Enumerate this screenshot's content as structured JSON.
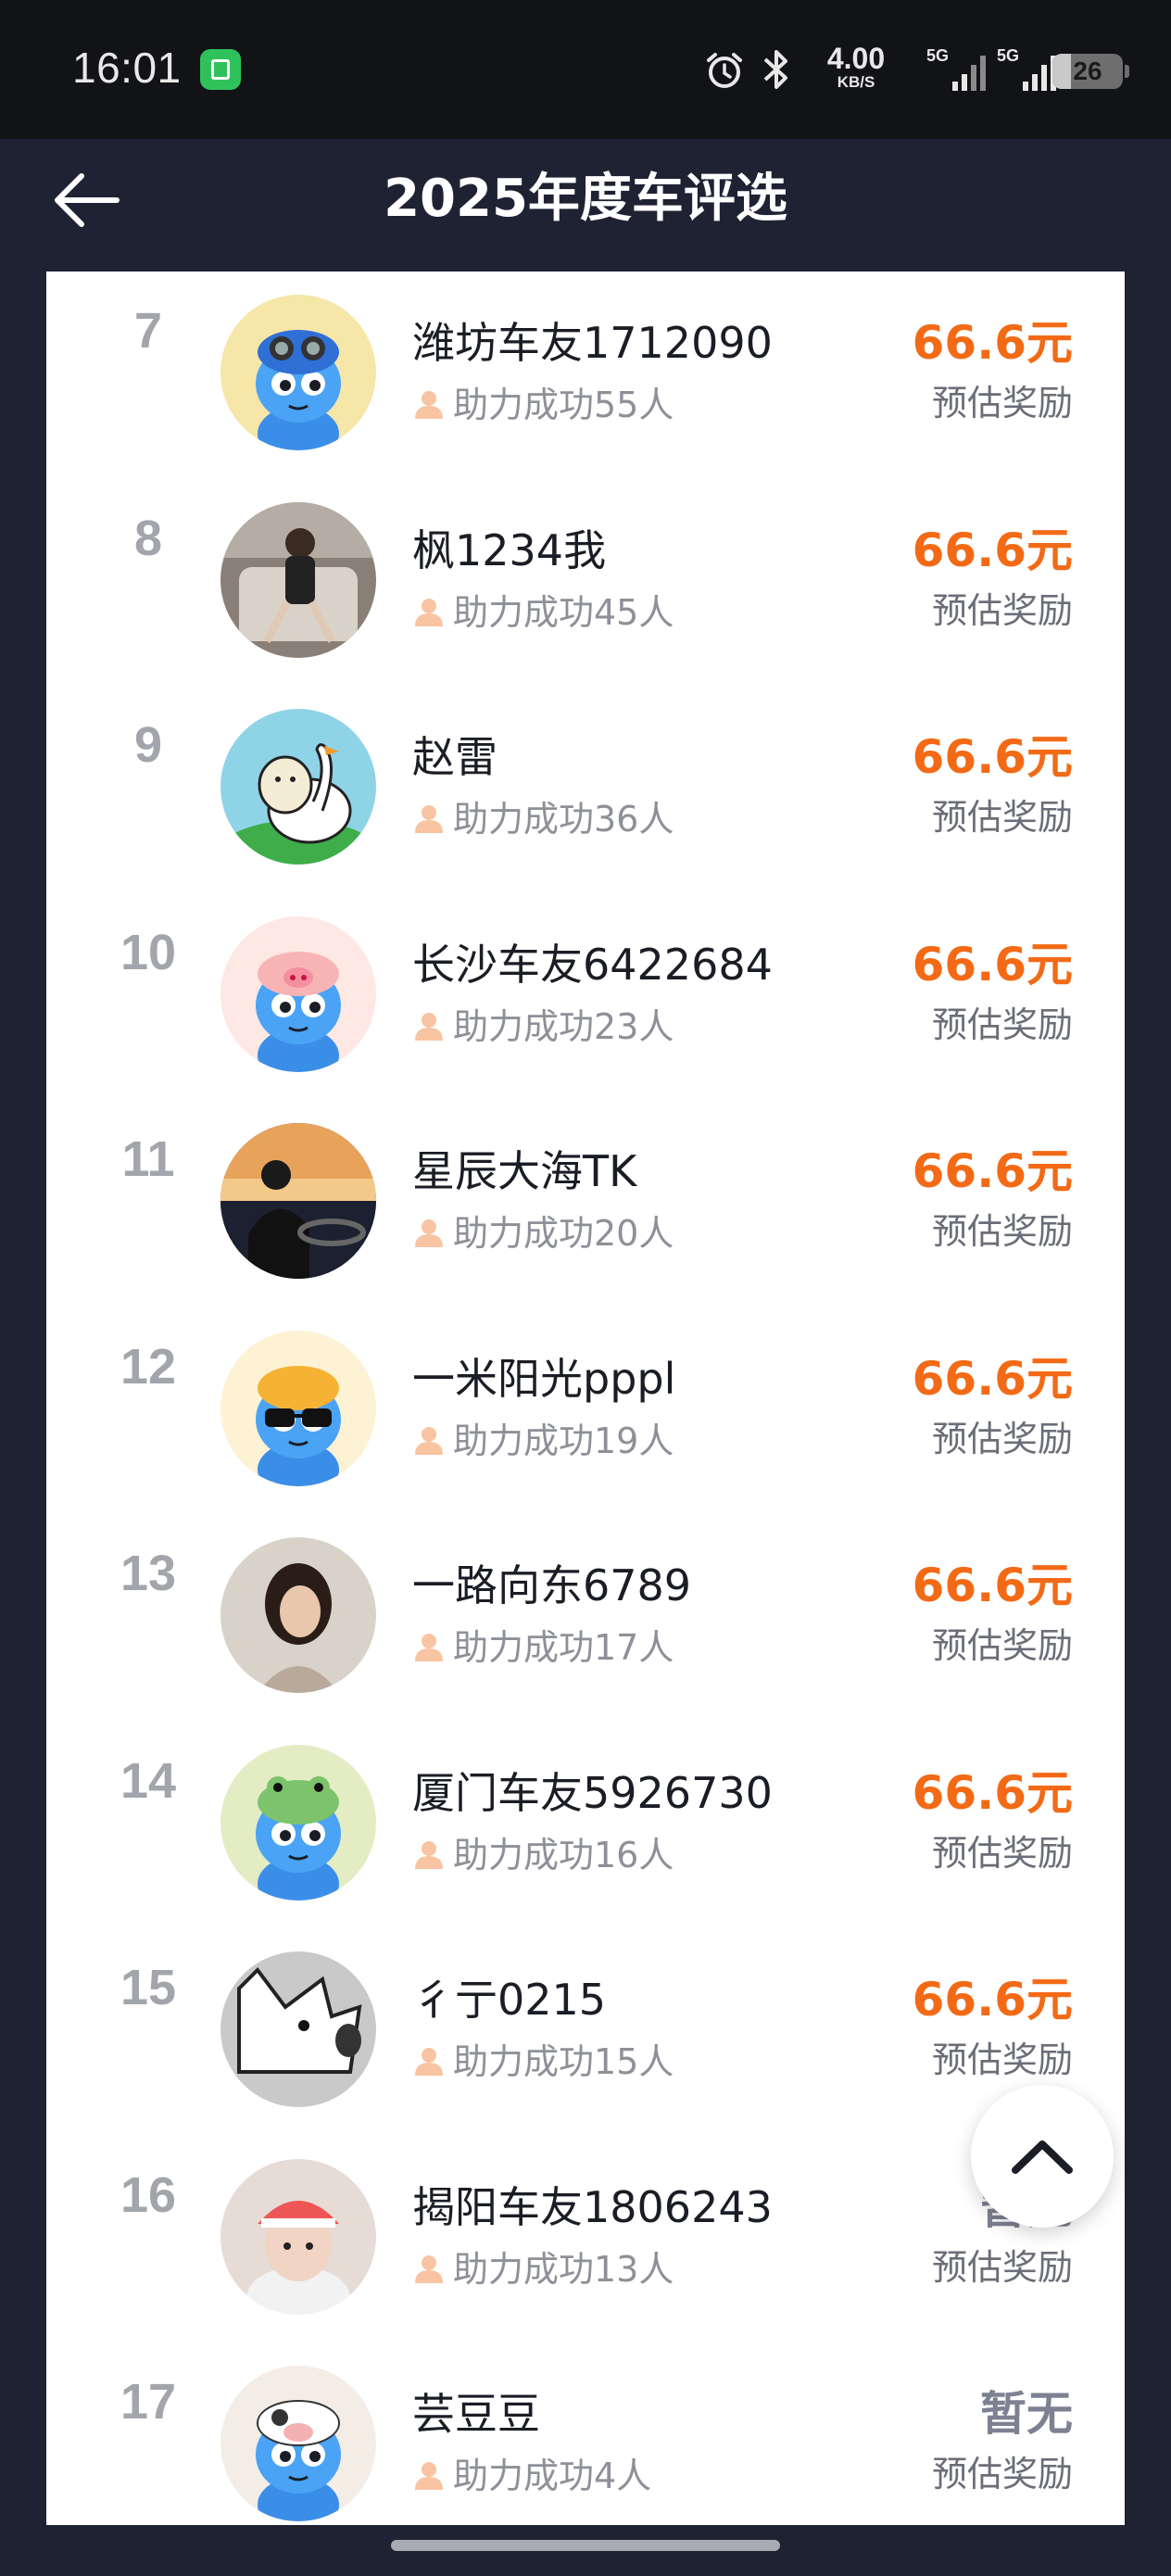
{
  "status_bar": {
    "time": "16:01",
    "net_speed_value": "4.00",
    "net_speed_unit": "KB/S",
    "sim1_tag": "5G",
    "sim2_tag": "5G",
    "battery": "26",
    "battery_level": 0.26
  },
  "header": {
    "title": "2025年度车评选",
    "back_icon": "arrow-left-icon"
  },
  "colors": {
    "reward": "#f36a16",
    "reward_none": "#7d8191",
    "rank": "#a3a5ac",
    "background": "#1e2233"
  },
  "list": [
    {
      "rank": "7",
      "name": "潍坊车友1712090",
      "helped": "助力成功55人",
      "reward": "66.6元",
      "reward_label": "预估奖励",
      "has_reward": true,
      "avatar": "blue-mascot-goggles"
    },
    {
      "rank": "8",
      "name": "枫1234我",
      "helped": "助力成功45人",
      "reward": "66.6元",
      "reward_label": "预估奖励",
      "has_reward": true,
      "avatar": "photo-woman-sofa"
    },
    {
      "rank": "9",
      "name": "赵雷",
      "helped": "助力成功36人",
      "reward": "66.6元",
      "reward_label": "预估奖励",
      "has_reward": true,
      "avatar": "cat-and-goose"
    },
    {
      "rank": "10",
      "name": "长沙车友6422684",
      "helped": "助力成功23人",
      "reward": "66.6元",
      "reward_label": "预估奖励",
      "has_reward": true,
      "avatar": "blue-mascot-pig-hat"
    },
    {
      "rank": "11",
      "name": "星辰大海TK",
      "helped": "助力成功20人",
      "reward": "66.6元",
      "reward_label": "预估奖励",
      "has_reward": true,
      "avatar": "photo-sunset-driver"
    },
    {
      "rank": "12",
      "name": "一米阳光pppl",
      "helped": "助力成功19人",
      "reward": "66.6元",
      "reward_label": "预估奖励",
      "has_reward": true,
      "avatar": "blue-mascot-sunglasses"
    },
    {
      "rank": "13",
      "name": "一路向东6789",
      "helped": "助力成功17人",
      "reward": "66.6元",
      "reward_label": "预估奖励",
      "has_reward": true,
      "avatar": "photo-woman-portrait"
    },
    {
      "rank": "14",
      "name": "厦门车友5926730",
      "helped": "助力成功16人",
      "reward": "66.6元",
      "reward_label": "预估奖励",
      "has_reward": true,
      "avatar": "blue-mascot-frog-hat"
    },
    {
      "rank": "15",
      "name": "彳亍0215",
      "helped": "助力成功15人",
      "reward": "66.6元",
      "reward_label": "预估奖励",
      "has_reward": true,
      "avatar": "sketch-cat-gray"
    },
    {
      "rank": "16",
      "name": "揭阳车友1806243",
      "helped": "助力成功13人",
      "reward": "暂无",
      "reward_label": "预估奖励",
      "has_reward": false,
      "avatar": "photo-child-cap"
    },
    {
      "rank": "17",
      "name": "芸豆豆",
      "helped": "助力成功4人",
      "reward": "暂无",
      "reward_label": "预估奖励",
      "has_reward": false,
      "avatar": "blue-mascot-cow-hat"
    }
  ],
  "scroll_top_icon": "chevron-up-icon"
}
